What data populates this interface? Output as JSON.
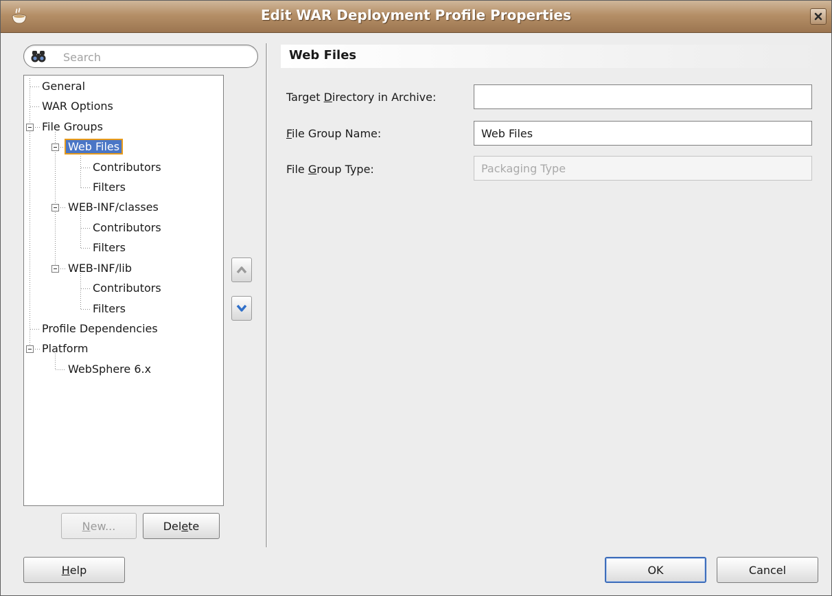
{
  "window": {
    "title": "Edit WAR Deployment Profile Properties"
  },
  "search": {
    "placeholder": "Search"
  },
  "tree": {
    "items": [
      {
        "label": "General"
      },
      {
        "label": "WAR Options"
      },
      {
        "label": "File Groups"
      },
      {
        "label": "Web Files",
        "selected": true
      },
      {
        "label": "Contributors"
      },
      {
        "label": "Filters"
      },
      {
        "label": "WEB-INF/classes"
      },
      {
        "label": "Contributors"
      },
      {
        "label": "Filters"
      },
      {
        "label": "WEB-INF/lib"
      },
      {
        "label": "Contributors"
      },
      {
        "label": "Filters"
      },
      {
        "label": "Profile Dependencies"
      },
      {
        "label": "Platform"
      },
      {
        "label": "WebSphere 6.x"
      }
    ]
  },
  "tree_buttons": {
    "new": {
      "pre": "",
      "mnemonic": "N",
      "post": "ew..."
    },
    "delete": {
      "pre": "Del",
      "mnemonic": "e",
      "post": "te"
    }
  },
  "panel": {
    "title": "Web Files",
    "target_dir": {
      "pre": "Target ",
      "mnemonic": "D",
      "post": "irectory in Archive:",
      "value": ""
    },
    "group_name": {
      "pre": "",
      "mnemonic": "F",
      "post": "ile Group Name:",
      "value": "Web Files"
    },
    "group_type": {
      "pre": "File ",
      "mnemonic": "G",
      "post": "roup Type:",
      "placeholder": "Packaging Type"
    }
  },
  "footer": {
    "help": {
      "pre": "",
      "mnemonic": "H",
      "post": "elp"
    },
    "ok": "OK",
    "cancel": "Cancel"
  },
  "icons": {
    "app": "coffee-cup-icon",
    "close": "close-icon",
    "search": "binoculars-icon",
    "move_up": "chevron-up-icon",
    "move_down": "chevron-down-icon"
  },
  "colors": {
    "selection": "#4a76c6",
    "selection_outline": "#e79a1a",
    "titlebar": "#b58f67"
  }
}
